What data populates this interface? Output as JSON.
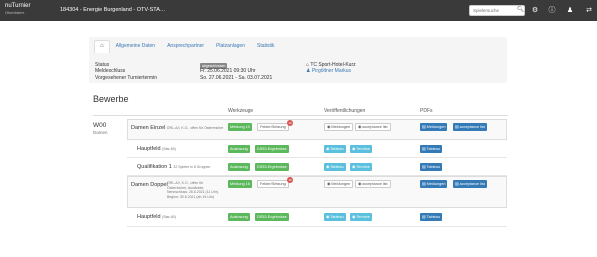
{
  "app": {
    "name": "nuTurnier",
    "subtitle": "Oberösterr."
  },
  "header": {
    "breadcrumb": "184304 - Energie Burgenland - OTV-STA…",
    "search_placeholder": "Spielersuche"
  },
  "tabs": [
    {
      "label": "Allgemeine Daten"
    },
    {
      "label": "Ansprechpartner"
    },
    {
      "label": "Platzanlagen"
    },
    {
      "label": "Statistik"
    }
  ],
  "info": {
    "status_label": "Status",
    "status_badge": "abgeschlossen",
    "deadline_label": "Meldeschluss",
    "deadline_value": "Fr. 25.06.2021 09:30 Uhr",
    "date_label": "Vorgesehener Turniertermin",
    "date_value": "So. 27.06.2021 - Sa. 03.07.2021",
    "club": "TC Sport-Hotel-Kurz",
    "contact": "Pirgöltner Markus"
  },
  "bewerbe": {
    "heading": "Bewerbe",
    "col_werkzeuge": "Werkzeuge",
    "col_veroeffentlichungen": "Veröffentlichungen",
    "col_pdfs": "PDFs",
    "group_code": "W00",
    "group_sub": "Damen",
    "rows": [
      {
        "name": "Damen Einzel",
        "small": "ÖRL-A/I, K.O., offen für Österreicher",
        "desc": "",
        "tools": [
          "Meldung 10",
          "Felder/Setzung"
        ],
        "tool_badge": "10",
        "pubs": [
          "Meldungen",
          "acceptance list"
        ],
        "pdfs": [
          "Meldungen",
          "acceptance list"
        ]
      },
      {
        "name": "Hauptfeld",
        "small": "(Star-60)",
        "desc": "",
        "tools": [
          "Auslosung",
          "DS53-Ergebnisse"
        ],
        "tool_badge": "",
        "pubs": [
          "Tableau",
          "Termine"
        ],
        "pdfs": [
          "Tableau"
        ]
      },
      {
        "name": "Qualifikation 1",
        "small": "32 Spieler in 8 Gruppen",
        "desc": "",
        "tools": [
          "Auslosung",
          "DS53-Ergebnisse"
        ],
        "tool_badge": "",
        "pubs": [
          "Tableau",
          "Termine"
        ],
        "pdfs": [
          "Tableau"
        ]
      },
      {
        "name": "Damen Doppel",
        "small": "ÖRL-A/I, K.O., offen für Österreicher, Ausländer, Nennschluss: 26.6.2021 (11 Uhr), Beginn: 30.6.2021 (ab 15 Uhr)",
        "desc": "",
        "tools": [
          "Meldung 16",
          "Felder/Setzung"
        ],
        "tool_badge": "16",
        "pubs": [
          "Meldungen",
          "acceptance list"
        ],
        "pdfs": [
          "Meldungen",
          "acceptance list"
        ]
      },
      {
        "name": "Hauptfeld",
        "small": "(Star-60)",
        "desc": "",
        "tools": [
          "Auslosung",
          "DS53-Ergebnisse"
        ],
        "tool_badge": "",
        "pubs": [
          "Tableau",
          "Termine"
        ],
        "pdfs": [
          "Tableau"
        ]
      }
    ]
  }
}
